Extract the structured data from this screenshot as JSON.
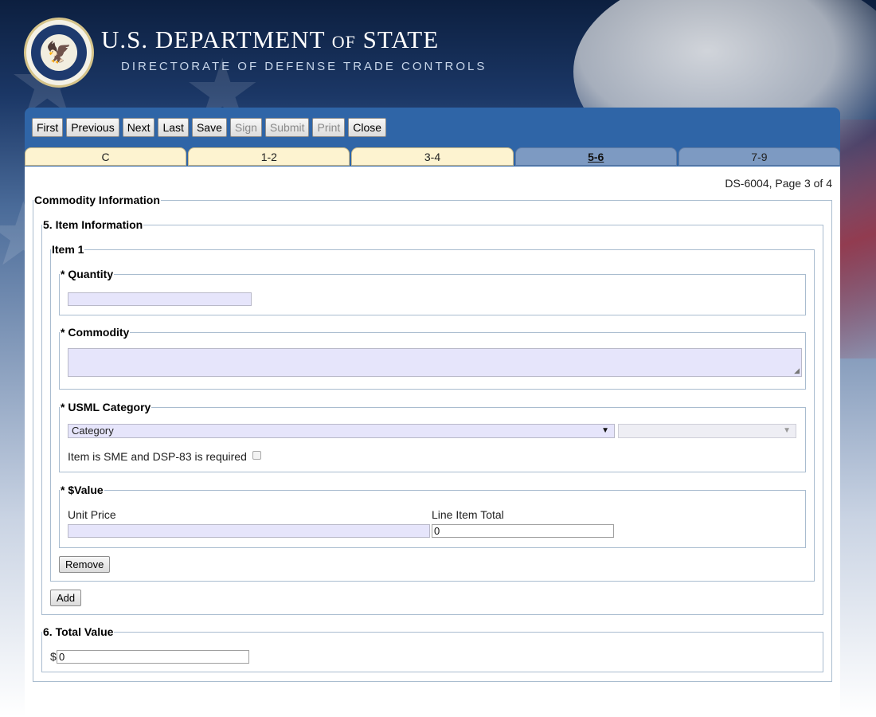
{
  "header": {
    "dept_main": "U.S. DEPARTMENT",
    "dept_of": "OF",
    "dept_state": "STATE",
    "directorate": "DIRECTORATE OF DEFENSE TRADE CONTROLS"
  },
  "toolbar": {
    "buttons": [
      {
        "label": "First",
        "enabled": true
      },
      {
        "label": "Previous",
        "enabled": true
      },
      {
        "label": "Next",
        "enabled": true
      },
      {
        "label": "Last",
        "enabled": true
      },
      {
        "label": "Save",
        "enabled": true
      },
      {
        "label": "Sign",
        "enabled": false
      },
      {
        "label": "Submit",
        "enabled": false
      },
      {
        "label": "Print",
        "enabled": false
      },
      {
        "label": "Close",
        "enabled": true
      }
    ]
  },
  "tabs": [
    {
      "label": "C",
      "active": false
    },
    {
      "label": "1-2",
      "active": false
    },
    {
      "label": "3-4",
      "active": false
    },
    {
      "label": "5-6",
      "active": true
    },
    {
      "label": "7-9",
      "active": false
    }
  ],
  "page_info": "DS-6004, Page 3 of 4",
  "form": {
    "commodity_info_legend": "Commodity Information",
    "item_info_legend": "5. Item Information",
    "item1_legend": "Item 1",
    "quantity_legend": "* Quantity",
    "quantity_value": "",
    "commodity_legend": "* Commodity",
    "commodity_value": "",
    "usml_legend": "* USML Category",
    "category_select": "Category",
    "subcategory_select": "",
    "sme_label": "Item is SME and DSP-83 is required",
    "value_legend": "* $Value",
    "unit_price_label": "Unit Price",
    "unit_price_value": "",
    "line_total_label": "Line Item Total",
    "line_total_value": "0",
    "remove_label": "Remove",
    "add_label": "Add",
    "total_value_legend": "6. Total Value",
    "dollar_sign": "$",
    "total_value": "0"
  }
}
